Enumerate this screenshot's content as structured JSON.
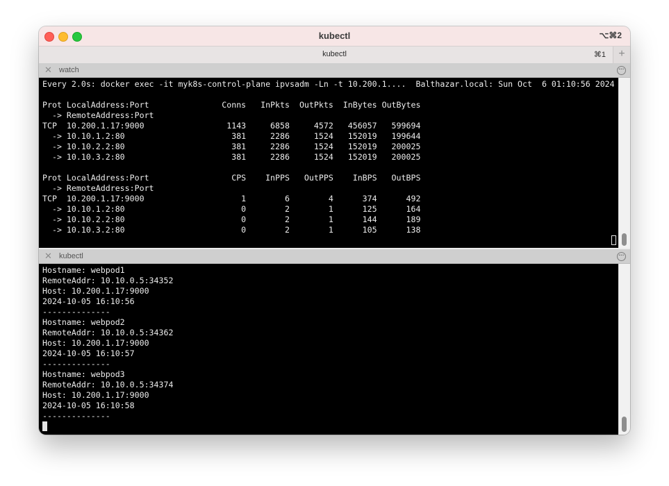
{
  "window": {
    "title": "kubectl",
    "shortcut": "⌥⌘2"
  },
  "tab": {
    "label": "kubectl",
    "shortcut": "⌘1",
    "add_label": "+"
  },
  "top_pane": {
    "title": "watch",
    "close_glyph": "✕",
    "menu_glyph": "···",
    "content": "Every 2.0s: docker exec -it myk8s-control-plane ipvsadm -Ln -t 10.200.1....  Balthazar.local: Sun Oct  6 01:10:56 2024\n\nProt LocalAddress:Port               Conns   InPkts  OutPkts  InBytes OutBytes\n  -> RemoteAddress:Port\nTCP  10.200.1.17:9000                 1143     6858     4572   456057   599694\n  -> 10.10.1.2:80                      381     2286     1524   152019   199644\n  -> 10.10.2.2:80                      381     2286     1524   152019   200025\n  -> 10.10.3.2:80                      381     2286     1524   152019   200025\n\nProt LocalAddress:Port                 CPS    InPPS   OutPPS    InBPS   OutBPS\n  -> RemoteAddress:Port\nTCP  10.200.1.17:9000                    1        6        4      374      492\n  -> 10.10.1.2:80                        0        2        1      125      164\n  -> 10.10.2.2:80                        0        2        1      144      189\n  -> 10.10.3.2:80                        0        2        1      105      138"
  },
  "bottom_pane": {
    "title": "kubectl",
    "close_glyph": "✕",
    "menu_glyph": "···",
    "content": "Hostname: webpod1\nRemoteAddr: 10.10.0.5:34352\nHost: 10.200.1.17:9000\n2024-10-05 16:10:56\n--------------\nHostname: webpod2\nRemoteAddr: 10.10.0.5:34362\nHost: 10.200.1.17:9000\n2024-10-05 16:10:57\n--------------\nHostname: webpod3\nRemoteAddr: 10.10.0.5:34374\nHost: 10.200.1.17:9000\n2024-10-05 16:10:58\n--------------"
  }
}
